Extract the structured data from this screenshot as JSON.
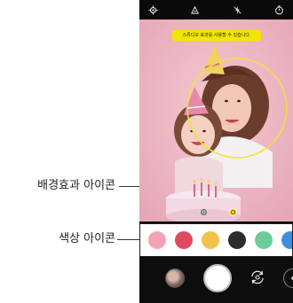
{
  "callouts": {
    "background_effect_label": "배경효과 아이콘",
    "color_label": "색상 아이콘"
  },
  "camera": {
    "topbar_icons": [
      "settings-icon",
      "sticker-icon",
      "flash-off-icon",
      "timer-icon"
    ],
    "toast_text": "스튜디오 효과를 사용할 수 있습니다.",
    "effect_icons": [
      "blur-effect-icon",
      "background-effect-icon"
    ],
    "color_swatches": [
      "#f4a3b7",
      "#e04a5f",
      "#f2c24b",
      "#2c2c2c",
      "#6dcc9c",
      "#3c8fe0"
    ],
    "accent": "#f2e600",
    "bottom_icons": [
      "gallery-thumbnail",
      "shutter-button",
      "switch-camera-icon",
      "more-icon"
    ]
  }
}
